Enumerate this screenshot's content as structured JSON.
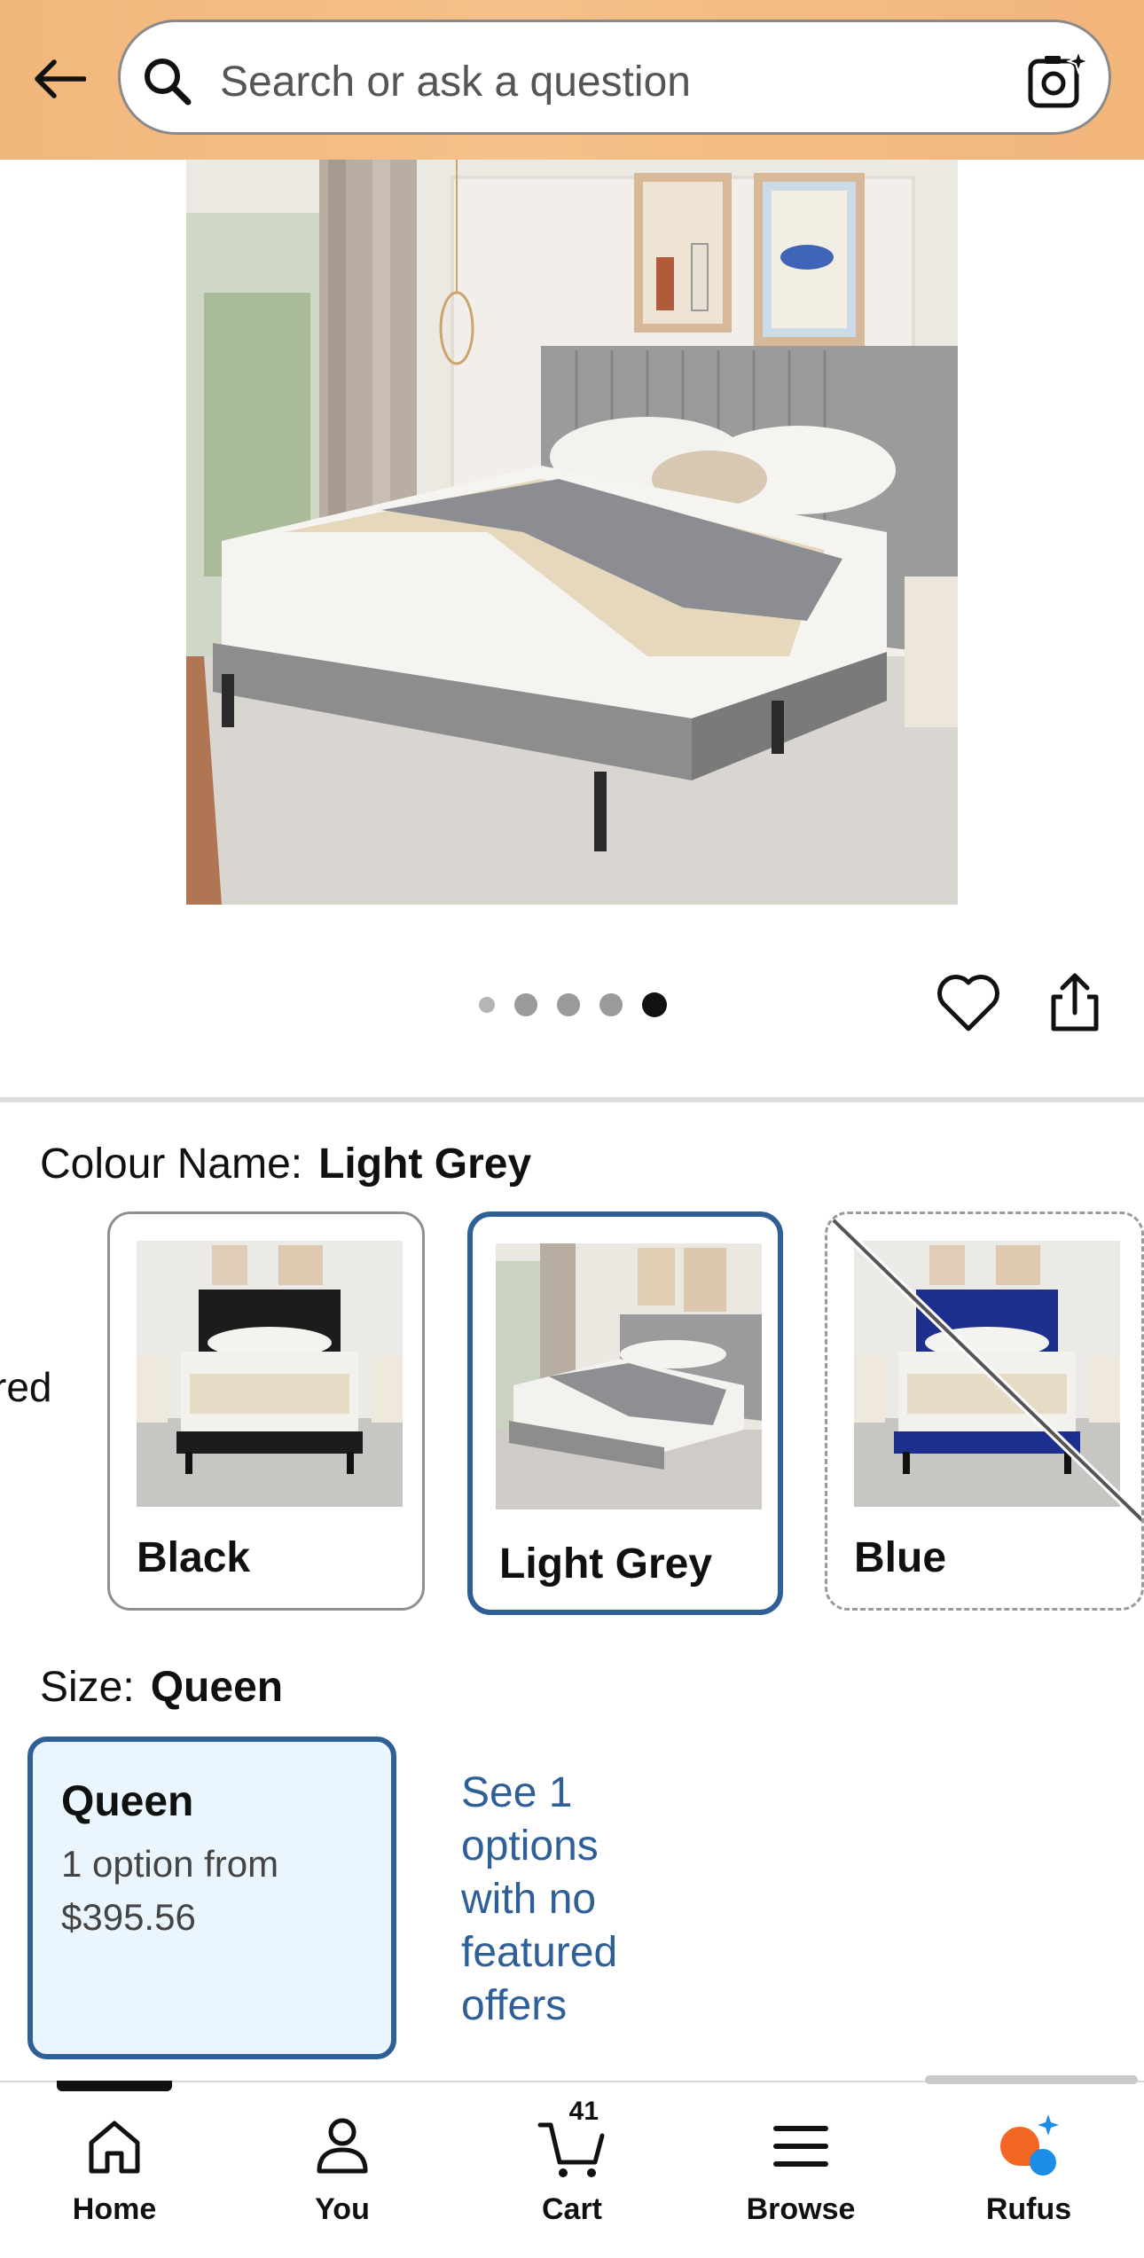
{
  "header": {
    "search_placeholder": "Search or ask a question"
  },
  "carousel": {
    "total_images": 5,
    "active_index": 4
  },
  "colour": {
    "label": "Colour Name:",
    "selected": "Light Grey",
    "partial_left_text": "red",
    "options": [
      {
        "label": "Black",
        "state": "available"
      },
      {
        "label": "Light Grey",
        "state": "selected"
      },
      {
        "label": "Blue",
        "state": "unavailable"
      }
    ]
  },
  "size": {
    "label": "Size:",
    "selected": "Queen",
    "card": {
      "title": "Queen",
      "subtitle": "1 option from $395.56"
    },
    "see_options": "See 1 options with no featured offers"
  },
  "nav": {
    "home": "Home",
    "you": "You",
    "cart": "Cart",
    "cart_count": "41",
    "browse": "Browse",
    "rufus": "Rufus"
  },
  "colors": {
    "header_bg": "#f5c08a",
    "selected_border": "#2f5f97",
    "selected_fill": "#ebf5fd",
    "link": "#2f5f97"
  }
}
